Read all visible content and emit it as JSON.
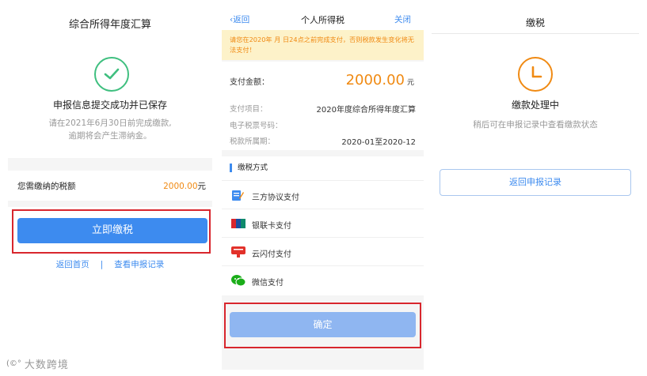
{
  "panel1": {
    "title": "综合所得年度汇算",
    "success_text": "申报信息提交成功并已保存",
    "hint_line1": "请在2021年6月30日前完成缴款,",
    "hint_line2": "逾期将会产生滞纳金。",
    "tax_label": "您需缴纳的税额",
    "tax_amount": "2000.00",
    "tax_unit": "元",
    "pay_button": "立即缴税",
    "link_home": "返回首页",
    "link_separator": "|",
    "link_records": "查看申报记录"
  },
  "panel2": {
    "back": "返回",
    "title": "个人所得税",
    "close": "关闭",
    "warning": "请您在2020年  月  日24点之前完成支付，否则税款发生变化将无法支付！",
    "amount_label": "支付金额：",
    "amount_value": "2000.00",
    "amount_unit": "元",
    "info": [
      {
        "key": "支付项目：",
        "value": "2020年度综合所得年度汇算"
      },
      {
        "key": "电子税票号码：",
        "value": ""
      },
      {
        "key": "税款所属期：",
        "value": "2020-01至2020-12"
      }
    ],
    "methods_header": "缴税方式",
    "methods": [
      {
        "label": "三方协议支付",
        "icon": "agreement-icon"
      },
      {
        "label": "银联卡支付",
        "icon": "unionpay-icon"
      },
      {
        "label": "云闪付支付",
        "icon": "quickpass-icon"
      },
      {
        "label": "微信支付",
        "icon": "wechat-icon"
      }
    ],
    "confirm_button": "确定"
  },
  "panel3": {
    "title": "缴税",
    "status": "缴款处理中",
    "hint": "稍后可在申报记录中查看缴款状态",
    "back_button": "返回申报记录"
  },
  "watermark": {
    "text": "大数跨境"
  },
  "colors": {
    "accent": "#3d8bef",
    "orange": "#f08a13",
    "success": "#3fbf7f",
    "highlight": "#d8262d"
  }
}
